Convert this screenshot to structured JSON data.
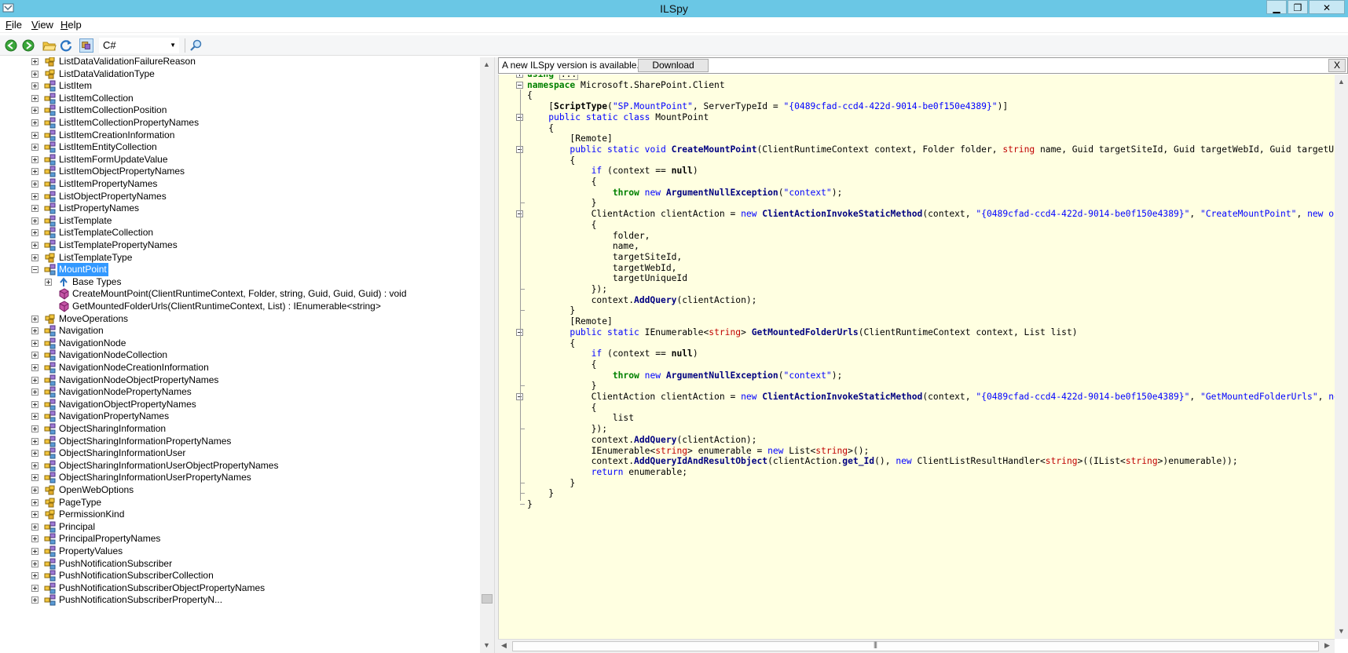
{
  "window": {
    "title": "ILSpy",
    "minimize": "▁",
    "maximize": "❐",
    "close": "✕"
  },
  "menu": [
    {
      "label": "File",
      "accel": "F",
      "rest": "ile"
    },
    {
      "label": "View",
      "accel": "V",
      "rest": "iew"
    },
    {
      "label": "Help",
      "accel": "H",
      "rest": "elp"
    }
  ],
  "toolbar": {
    "language": "C#",
    "icons": [
      "back-icon",
      "forward-icon",
      "open-folder-icon",
      "reload-icon",
      "show-internal-icon",
      "search-icon"
    ]
  },
  "tree": {
    "items": [
      {
        "label": "ListDataValidationFailureReason",
        "icon": "enum"
      },
      {
        "label": "ListDataValidationType",
        "icon": "enum"
      },
      {
        "label": "ListItem",
        "icon": "class"
      },
      {
        "label": "ListItemCollection",
        "icon": "class"
      },
      {
        "label": "ListItemCollectionPosition",
        "icon": "class"
      },
      {
        "label": "ListItemCollectionPropertyNames",
        "icon": "class"
      },
      {
        "label": "ListItemCreationInformation",
        "icon": "class"
      },
      {
        "label": "ListItemEntityCollection",
        "icon": "class"
      },
      {
        "label": "ListItemFormUpdateValue",
        "icon": "class"
      },
      {
        "label": "ListItemObjectPropertyNames",
        "icon": "class"
      },
      {
        "label": "ListItemPropertyNames",
        "icon": "class"
      },
      {
        "label": "ListObjectPropertyNames",
        "icon": "class"
      },
      {
        "label": "ListPropertyNames",
        "icon": "class"
      },
      {
        "label": "ListTemplate",
        "icon": "class"
      },
      {
        "label": "ListTemplateCollection",
        "icon": "class"
      },
      {
        "label": "ListTemplatePropertyNames",
        "icon": "class"
      },
      {
        "label": "ListTemplateType",
        "icon": "enum"
      },
      {
        "label": "MountPoint",
        "icon": "class",
        "selected": true,
        "expanded": true
      },
      {
        "label": "Base Types",
        "icon": "basetypes",
        "child": true
      },
      {
        "label": "CreateMountPoint(ClientRuntimeContext, Folder, string, Guid, Guid, Guid) : void",
        "icon": "method",
        "child": true,
        "noexp": true
      },
      {
        "label": "GetMountedFolderUrls(ClientRuntimeContext, List) : IEnumerable<string>",
        "icon": "method",
        "child": true,
        "noexp": true
      },
      {
        "label": "MoveOperations",
        "icon": "enum"
      },
      {
        "label": "Navigation",
        "icon": "class"
      },
      {
        "label": "NavigationNode",
        "icon": "class"
      },
      {
        "label": "NavigationNodeCollection",
        "icon": "class"
      },
      {
        "label": "NavigationNodeCreationInformation",
        "icon": "class"
      },
      {
        "label": "NavigationNodeObjectPropertyNames",
        "icon": "class"
      },
      {
        "label": "NavigationNodePropertyNames",
        "icon": "class"
      },
      {
        "label": "NavigationObjectPropertyNames",
        "icon": "class"
      },
      {
        "label": "NavigationPropertyNames",
        "icon": "class"
      },
      {
        "label": "ObjectSharingInformation",
        "icon": "class"
      },
      {
        "label": "ObjectSharingInformationPropertyNames",
        "icon": "class"
      },
      {
        "label": "ObjectSharingInformationUser",
        "icon": "class"
      },
      {
        "label": "ObjectSharingInformationUserObjectPropertyNames",
        "icon": "class"
      },
      {
        "label": "ObjectSharingInformationUserPropertyNames",
        "icon": "class"
      },
      {
        "label": "OpenWebOptions",
        "icon": "enum"
      },
      {
        "label": "PageType",
        "icon": "enum"
      },
      {
        "label": "PermissionKind",
        "icon": "enum"
      },
      {
        "label": "Principal",
        "icon": "class"
      },
      {
        "label": "PrincipalPropertyNames",
        "icon": "class"
      },
      {
        "label": "PropertyValues",
        "icon": "class"
      },
      {
        "label": "PushNotificationSubscriber",
        "icon": "class"
      },
      {
        "label": "PushNotificationSubscriberCollection",
        "icon": "class"
      },
      {
        "label": "PushNotificationSubscriberObjectPropertyNames",
        "icon": "class"
      },
      {
        "label": "PushNotificationSubscriberPropertyN...",
        "icon": "class"
      }
    ]
  },
  "update_bar": {
    "message": "A new ILSpy version is available.",
    "download": "Download",
    "close": "X"
  },
  "code": {
    "lines": [
      [
        [
          "kwg",
          "using"
        ],
        [
          "t",
          " "
        ],
        [
          "box",
          "..."
        ]
      ],
      [
        [
          "kwg",
          "namespace"
        ],
        [
          "t",
          " Microsoft.SharePoint.Client"
        ]
      ],
      [
        [
          "t",
          "{"
        ]
      ],
      [
        [
          "t",
          "    ["
        ],
        [
          "ty",
          "ScriptType"
        ],
        [
          "t",
          "("
        ],
        [
          "st",
          "\"SP.MountPoint\""
        ],
        [
          "t",
          ", ServerTypeId = "
        ],
        [
          "st",
          "\"{0489cfad-ccd4-422d-9014-be0f150e4389}\""
        ],
        [
          "t",
          ")]"
        ]
      ],
      [
        [
          "t",
          "    "
        ],
        [
          "kw",
          "public static class"
        ],
        [
          "t",
          " MountPoint"
        ]
      ],
      [
        [
          "t",
          "    {"
        ]
      ],
      [
        [
          "t",
          "        [Remote]"
        ]
      ],
      [
        [
          "t",
          "        "
        ],
        [
          "kw",
          "public static void"
        ],
        [
          "t",
          " "
        ],
        [
          "mt",
          "CreateMountPoint"
        ],
        [
          "t",
          "(ClientRuntimeContext context, Folder folder, "
        ],
        [
          "sk",
          "string"
        ],
        [
          "t",
          " name, Guid targetSiteId, Guid targetWebId, Guid targetUniqueId)"
        ]
      ],
      [
        [
          "t",
          "        {"
        ]
      ],
      [
        [
          "t",
          "            "
        ],
        [
          "kw",
          "if"
        ],
        [
          "t",
          " (context == "
        ],
        [
          "kwb",
          "null"
        ],
        [
          "t",
          ")"
        ]
      ],
      [
        [
          "t",
          "            {"
        ]
      ],
      [
        [
          "t",
          "                "
        ],
        [
          "kwg",
          "throw"
        ],
        [
          "t",
          " "
        ],
        [
          "kw",
          "new"
        ],
        [
          "t",
          " "
        ],
        [
          "mt",
          "ArgumentNullException"
        ],
        [
          "t",
          "("
        ],
        [
          "st",
          "\"context\""
        ],
        [
          "t",
          ");"
        ]
      ],
      [
        [
          "t",
          "            }"
        ]
      ],
      [
        [
          "t",
          "            ClientAction clientAction = "
        ],
        [
          "kw",
          "new"
        ],
        [
          "t",
          " "
        ],
        [
          "mt",
          "ClientActionInvokeStaticMethod"
        ],
        [
          "t",
          "(context, "
        ],
        [
          "st",
          "\"{0489cfad-ccd4-422d-9014-be0f150e4389}\""
        ],
        [
          "t",
          ", "
        ],
        [
          "st",
          "\"CreateMountPoint\""
        ],
        [
          "t",
          ", "
        ],
        [
          "kw",
          "new object[]"
        ]
      ],
      [
        [
          "t",
          "            {"
        ]
      ],
      [
        [
          "t",
          "                folder,"
        ]
      ],
      [
        [
          "t",
          "                name,"
        ]
      ],
      [
        [
          "t",
          "                targetSiteId,"
        ]
      ],
      [
        [
          "t",
          "                targetWebId,"
        ]
      ],
      [
        [
          "t",
          "                targetUniqueId"
        ]
      ],
      [
        [
          "t",
          "            });"
        ]
      ],
      [
        [
          "t",
          "            context."
        ],
        [
          "mt",
          "AddQuery"
        ],
        [
          "t",
          "(clientAction);"
        ]
      ],
      [
        [
          "t",
          "        }"
        ]
      ],
      [
        [
          "t",
          "        [Remote]"
        ]
      ],
      [
        [
          "t",
          "        "
        ],
        [
          "kw",
          "public static"
        ],
        [
          "t",
          " IEnumerable<"
        ],
        [
          "sk",
          "string"
        ],
        [
          "t",
          "> "
        ],
        [
          "mt",
          "GetMountedFolderUrls"
        ],
        [
          "t",
          "(ClientRuntimeContext context, List list)"
        ]
      ],
      [
        [
          "t",
          "        {"
        ]
      ],
      [
        [
          "t",
          "            "
        ],
        [
          "kw",
          "if"
        ],
        [
          "t",
          " (context == "
        ],
        [
          "kwb",
          "null"
        ],
        [
          "t",
          ")"
        ]
      ],
      [
        [
          "t",
          "            {"
        ]
      ],
      [
        [
          "t",
          "                "
        ],
        [
          "kwg",
          "throw"
        ],
        [
          "t",
          " "
        ],
        [
          "kw",
          "new"
        ],
        [
          "t",
          " "
        ],
        [
          "mt",
          "ArgumentNullException"
        ],
        [
          "t",
          "("
        ],
        [
          "st",
          "\"context\""
        ],
        [
          "t",
          ");"
        ]
      ],
      [
        [
          "t",
          "            }"
        ]
      ],
      [
        [
          "t",
          "            ClientAction clientAction = "
        ],
        [
          "kw",
          "new"
        ],
        [
          "t",
          " "
        ],
        [
          "mt",
          "ClientActionInvokeStaticMethod"
        ],
        [
          "t",
          "(context, "
        ],
        [
          "st",
          "\"{0489cfad-ccd4-422d-9014-be0f150e4389}\""
        ],
        [
          "t",
          ", "
        ],
        [
          "st",
          "\"GetMountedFolderUrls\""
        ],
        [
          "t",
          ", "
        ],
        [
          "kw",
          "new object[]"
        ]
      ],
      [
        [
          "t",
          "            {"
        ]
      ],
      [
        [
          "t",
          "                list"
        ]
      ],
      [
        [
          "t",
          "            });"
        ]
      ],
      [
        [
          "t",
          "            context."
        ],
        [
          "mt",
          "AddQuery"
        ],
        [
          "t",
          "(clientAction);"
        ]
      ],
      [
        [
          "t",
          "            IEnumerable<"
        ],
        [
          "sk",
          "string"
        ],
        [
          "t",
          "> enumerable = "
        ],
        [
          "kw",
          "new"
        ],
        [
          "t",
          " List<"
        ],
        [
          "sk",
          "string"
        ],
        [
          "t",
          ">();"
        ]
      ],
      [
        [
          "t",
          "            context."
        ],
        [
          "mt",
          "AddQueryIdAndResultObject"
        ],
        [
          "t",
          "(clientAction."
        ],
        [
          "mt",
          "get_Id"
        ],
        [
          "t",
          "(), "
        ],
        [
          "kw",
          "new"
        ],
        [
          "t",
          " ClientListResultHandler<"
        ],
        [
          "sk",
          "string"
        ],
        [
          "t",
          ">((IList<"
        ],
        [
          "sk",
          "string"
        ],
        [
          "t",
          ">)enumerable));"
        ]
      ],
      [
        [
          "t",
          "            "
        ],
        [
          "kw",
          "return"
        ],
        [
          "t",
          " enumerable;"
        ]
      ],
      [
        [
          "t",
          "        }"
        ]
      ],
      [
        [
          "t",
          "    }"
        ]
      ],
      [
        [
          "t",
          "}"
        ]
      ]
    ]
  }
}
